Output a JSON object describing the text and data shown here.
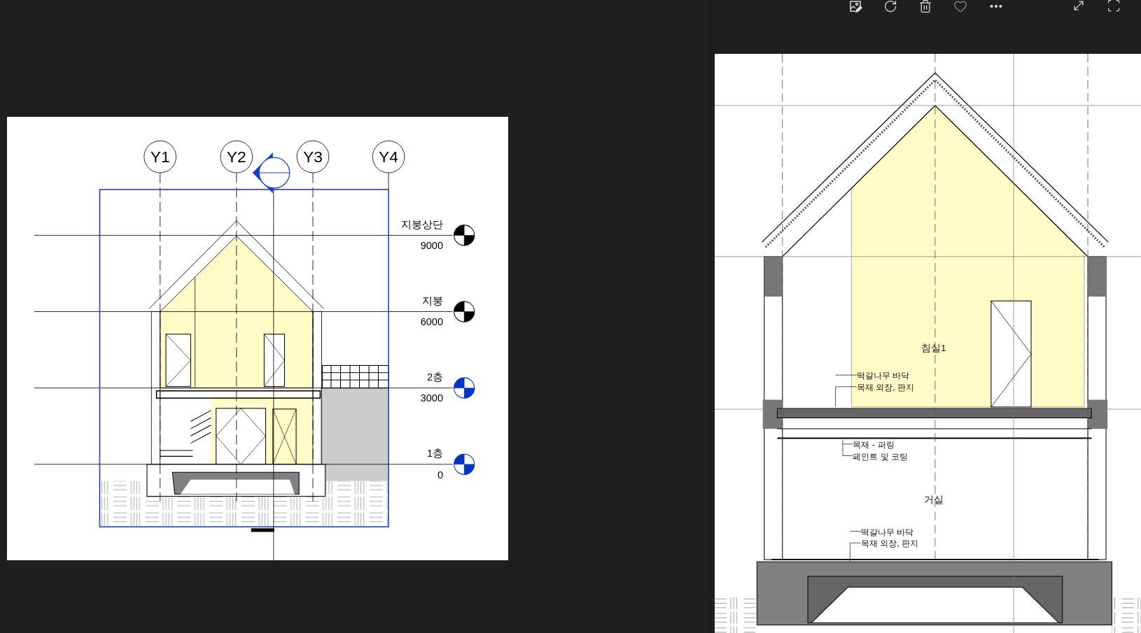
{
  "elevation_view": {
    "grid_labels": [
      "Y1",
      "Y2",
      "Y3",
      "Y4"
    ],
    "levels": [
      {
        "name": "지붕상단",
        "elevation": "9000",
        "color": "#000000"
      },
      {
        "name": "지붕",
        "elevation": "6000",
        "color": "#000000"
      },
      {
        "name": "2층",
        "elevation": "3000",
        "color": "#0033cc"
      },
      {
        "name": "1층",
        "elevation": "0",
        "color": "#0033cc"
      }
    ]
  },
  "section_view": {
    "rooms": [
      "침실1",
      "거실"
    ],
    "tags": [
      {
        "lines": [
          "떡갈나무 바닥",
          "목재 외장, 판지"
        ]
      },
      {
        "lines": [
          "목재 - 퍼링",
          "페인트 및 코팅"
        ]
      },
      {
        "lines": [
          "떡갈나무 바닥",
          "목재 외장, 판지"
        ]
      }
    ]
  }
}
